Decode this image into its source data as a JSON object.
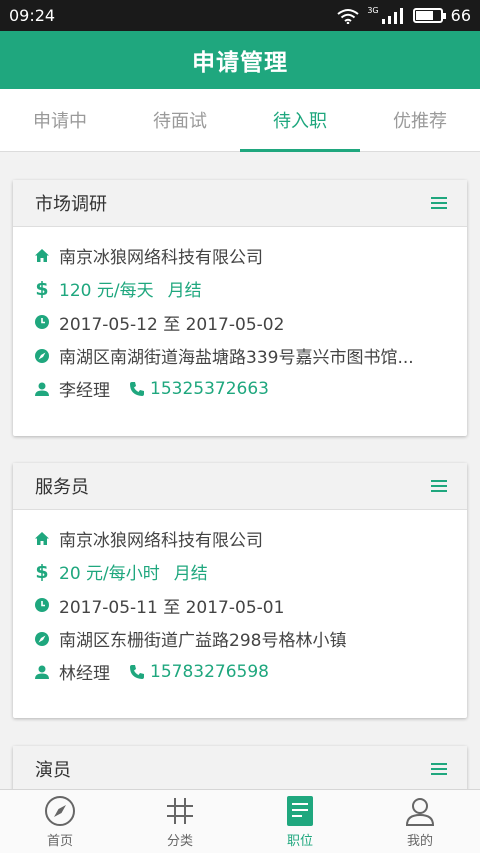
{
  "status_bar": {
    "time": "09:24",
    "battery": "66",
    "network": "3G"
  },
  "header": {
    "title": "申请管理"
  },
  "tabs": [
    {
      "label": "申请中",
      "active": false
    },
    {
      "label": "待面试",
      "active": false
    },
    {
      "label": "待入职",
      "active": true
    },
    {
      "label": "优推荐",
      "active": false
    }
  ],
  "jobs": [
    {
      "title": "市场调研",
      "company": "南京冰狼网络科技有限公司",
      "salary": "120 元/每天",
      "settlement": "月结",
      "dates": "2017-05-12 至 2017-05-02",
      "address": "南湖区南湖街道海盐塘路339号嘉兴市图书馆...",
      "contact": "李经理",
      "phone": "15325372663"
    },
    {
      "title": "服务员",
      "company": "南京冰狼网络科技有限公司",
      "salary": "20 元/每小时",
      "settlement": "月结",
      "dates": "2017-05-11 至 2017-05-01",
      "address": "南湖区东栅街道广益路298号格林小镇",
      "contact": "林经理",
      "phone": "15783276598"
    },
    {
      "title": "演员"
    }
  ],
  "bottom_nav": [
    {
      "label": "首页",
      "icon": "compass-icon",
      "active": false
    },
    {
      "label": "分类",
      "icon": "hash-icon",
      "active": false
    },
    {
      "label": "职位",
      "icon": "document-icon",
      "active": true
    },
    {
      "label": "我的",
      "icon": "user-icon",
      "active": false
    }
  ],
  "colors": {
    "accent": "#1fa77e",
    "status_bar": "#1a1a1a"
  }
}
